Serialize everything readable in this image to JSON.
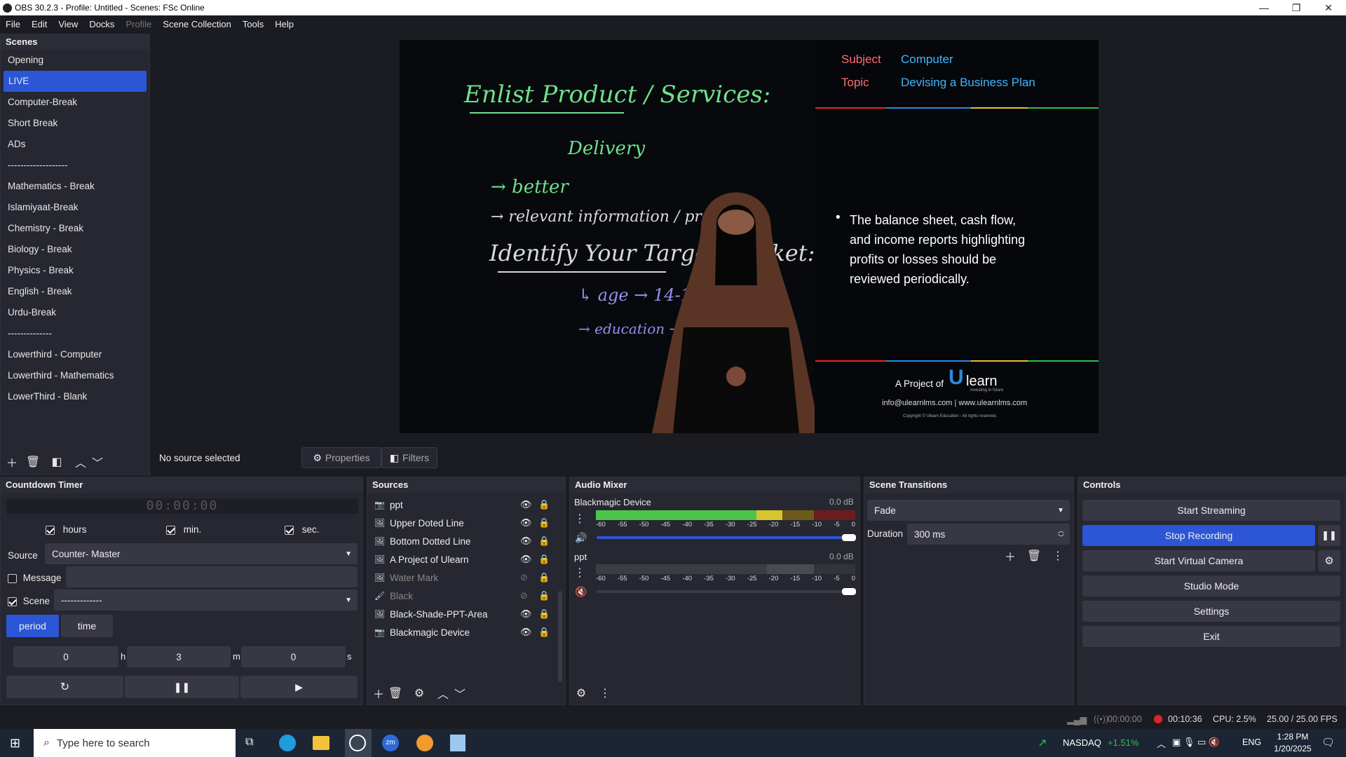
{
  "window": {
    "title": "OBS 30.2.3 - Profile: Untitled - Scenes: FSc Online",
    "minimize": "—",
    "maximize": "❐",
    "close": "✕"
  },
  "menu": [
    "File",
    "Edit",
    "View",
    "Docks",
    "Profile",
    "Scene Collection",
    "Tools",
    "Help"
  ],
  "scenes": {
    "title": "Scenes",
    "items": [
      "Opening",
      "LIVE",
      "Computer-Break",
      "Short Break",
      "ADs",
      "-------------------",
      "Mathematics - Break",
      "Islamiyaat-Break",
      "Chemistry  - Break",
      "Biology  - Break",
      "Physics  - Break",
      "English - Break",
      "Urdu-Break",
      "--------------",
      "Lowerthird - Computer",
      "Lowerthird - Mathematics",
      "LowerThird - Blank"
    ],
    "selected_index": 1
  },
  "preview": {
    "subject_label": "Subject",
    "subject_value": "Computer",
    "topic_label": "Topic",
    "topic_value": "Devising a Business Plan",
    "bullet_text_1": "The balance sheet, cash flow,",
    "bullet_text_2": "and income reports highlighting",
    "bullet_text_3": "profits or losses should be",
    "bullet_text_4": "reviewed periodically.",
    "project_of": "A Project of",
    "brand": "learn",
    "brand_u": "U",
    "brand_tagline": "Investing in future",
    "contact": "info@ulearnlms.com | www.ulearnlms.com",
    "copyright": "Copyright © Ulearn Education - All rights reserved.",
    "board_line_1": "Enlist Product / Services:",
    "board_line_2": "Delivery",
    "board_line_3": "→ better",
    "board_line_4": "→ relevant information / products",
    "board_line_5": "Identify Your Target Market:",
    "board_line_6": "↳ age → 14-16",
    "board_line_7": "→ education → matric"
  },
  "source_toolbar": {
    "no_source": "No source selected",
    "properties": "Properties",
    "filters": "Filters"
  },
  "countdown": {
    "title": "Countdown Timer",
    "display": "00:00:00",
    "hours_label": "hours",
    "min_label": "min.",
    "sec_label": "sec.",
    "source_label": "Source",
    "source_value": "Counter- Master",
    "message_label": "Message",
    "scene_label": "Scene",
    "scene_value": "-------------",
    "period_tab": "period",
    "time_tab": "time",
    "h_value": "0",
    "h_unit": "h",
    "m_value": "3",
    "m_unit": "m",
    "s_value": "0",
    "s_unit": "s"
  },
  "sources": {
    "title": "Sources",
    "items": [
      {
        "name": "ppt",
        "icon": "camera-icon",
        "visible": true
      },
      {
        "name": "Upper Doted Line",
        "icon": "image-icon",
        "visible": true
      },
      {
        "name": "Bottom Dotted Line",
        "icon": "image-icon",
        "visible": true
      },
      {
        "name": "A Project of Ulearn",
        "icon": "image-icon",
        "visible": true
      },
      {
        "name": "Water Mark",
        "icon": "image-icon",
        "visible": false
      },
      {
        "name": "Black",
        "icon": "brush-icon",
        "visible": false
      },
      {
        "name": "Black-Shade-PPT-Area",
        "icon": "image-icon",
        "visible": true
      },
      {
        "name": "Blackmagic Device",
        "icon": "camera-icon",
        "visible": true
      }
    ]
  },
  "audio": {
    "title": "Audio Mixer",
    "channels": [
      {
        "name": "Blackmagic Device",
        "db": "0.0 dB",
        "muted": false,
        "level": 1.0
      },
      {
        "name": "ppt",
        "db": "0.0 dB",
        "muted": true,
        "level": 1.0
      }
    ],
    "ticks": [
      "-60",
      "-55",
      "-50",
      "-45",
      "-40",
      "-35",
      "-30",
      "-25",
      "-20",
      "-15",
      "-10",
      "-5",
      "0"
    ]
  },
  "transitions": {
    "title": "Scene Transitions",
    "type": "Fade",
    "duration_label": "Duration",
    "duration_value": "300 ms"
  },
  "controls": {
    "title": "Controls",
    "start_streaming": "Start Streaming",
    "stop_recording": "Stop Recording",
    "start_virtual_camera": "Start Virtual Camera",
    "studio_mode": "Studio Mode",
    "settings": "Settings",
    "exit": "Exit"
  },
  "status": {
    "stream_time": "00:00:00",
    "rec_time": "00:10:36",
    "cpu": "CPU: 2.5%",
    "fps": "25.00 / 25.00 FPS"
  },
  "taskbar": {
    "search_placeholder": "Type here to search",
    "ticker_name": "NASDAQ",
    "ticker_change": "+1.51%",
    "lang": "ENG",
    "time": "1:28 PM",
    "date": "1/20/2025"
  },
  "colors": {
    "accent": "#2c56d6",
    "panel": "#262730",
    "background": "#1b1c22",
    "recording_red": "#e02424"
  }
}
